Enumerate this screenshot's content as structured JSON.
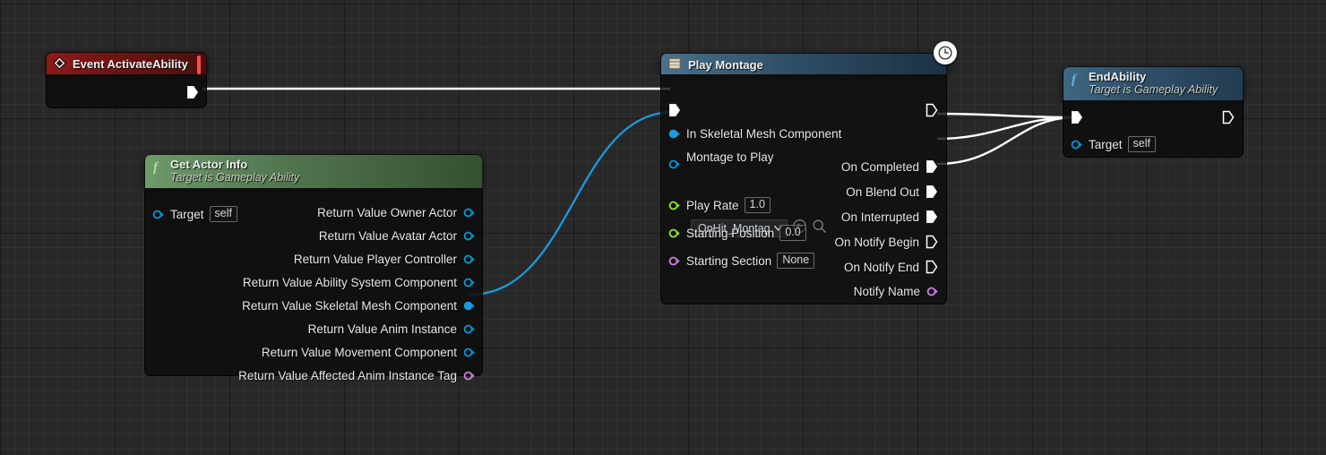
{
  "graph": {
    "background_color": "#282828",
    "grid_minor_color": "#333333",
    "grid_major_color": "#101010",
    "exec_wire_color": "#ffffff",
    "object_wire_color": "#189bdf"
  },
  "nodes": {
    "event_activate_ability": {
      "title": "Event ActivateAbility",
      "icon": "event-diamond-icon",
      "header_color": "#8d1a18",
      "breakpoint_icon": "red-square-icon",
      "exec_out_label": ""
    },
    "get_actor_info": {
      "title": "Get Actor Info",
      "subtitle": "Target is Gameplay Ability",
      "icon": "function-f-icon",
      "header_color": "#51754e",
      "inputs": [
        {
          "label": "Target",
          "value": "self",
          "pin_type": "object",
          "pin_color": "#0096d8",
          "connected": false
        }
      ],
      "outputs": [
        {
          "label": "Return Value Owner Actor",
          "pin_type": "object",
          "pin_color": "#0096d8",
          "connected": false
        },
        {
          "label": "Return Value Avatar Actor",
          "pin_type": "object",
          "pin_color": "#0096d8",
          "connected": false
        },
        {
          "label": "Return Value Player Controller",
          "pin_type": "object",
          "pin_color": "#0096d8",
          "connected": false
        },
        {
          "label": "Return Value Ability System Component",
          "pin_type": "object",
          "pin_color": "#0096d8",
          "connected": false
        },
        {
          "label": "Return Value Skeletal Mesh Component",
          "pin_type": "object",
          "pin_color": "#189bdf",
          "connected": true
        },
        {
          "label": "Return Value Anim Instance",
          "pin_type": "object",
          "pin_color": "#0096d8",
          "connected": false
        },
        {
          "label": "Return Value Movement Component",
          "pin_type": "object",
          "pin_color": "#0096d8",
          "connected": false
        },
        {
          "label": "Return Value Affected Anim Instance Tag",
          "pin_type": "struct",
          "pin_color": "#cc7bdd",
          "connected": false
        }
      ]
    },
    "play_montage": {
      "title": "Play Montage",
      "icon": "montage-asset-icon",
      "header_color": "#30506a",
      "latent_icon": "clock-icon",
      "inputs": [
        {
          "label": "",
          "pin_type": "exec",
          "connected": true
        },
        {
          "label": "In Skeletal Mesh Component",
          "pin_type": "object",
          "pin_color": "#189bdf",
          "connected": true
        },
        {
          "label": "Montage to Play",
          "pin_type": "object",
          "pin_color": "#0096d8",
          "connected": false,
          "combo_value": "OnHit_Montag",
          "combo_icon": "chevron-down-icon",
          "browse_icon": "browse-to-asset-icon",
          "search_icon": "magnifier-icon"
        },
        {
          "label": "Play Rate",
          "value": "1.0",
          "pin_type": "float",
          "pin_color": "#8fe02a",
          "connected": false
        },
        {
          "label": "Starting Position",
          "value": "0.0",
          "pin_type": "float",
          "pin_color": "#8fe02a",
          "connected": false
        },
        {
          "label": "Starting Section",
          "value": "None",
          "pin_type": "name",
          "pin_color": "#cc7bdd",
          "connected": false
        }
      ],
      "outputs": [
        {
          "label": "",
          "pin_type": "exec",
          "connected": false
        },
        {
          "label": "On Completed",
          "pin_type": "exec",
          "connected": true
        },
        {
          "label": "On Blend Out",
          "pin_type": "exec",
          "connected": true
        },
        {
          "label": "On Interrupted",
          "pin_type": "exec",
          "connected": true
        },
        {
          "label": "On Notify Begin",
          "pin_type": "exec",
          "connected": false
        },
        {
          "label": "On Notify End",
          "pin_type": "exec",
          "connected": false
        },
        {
          "label": "Notify Name",
          "pin_type": "name",
          "pin_color": "#cc7bdd",
          "connected": false
        }
      ]
    },
    "end_ability": {
      "title": "EndAbility",
      "subtitle": "Target is Gameplay Ability",
      "icon": "function-f-icon",
      "header_color": "#30506a",
      "inputs": [
        {
          "label": "",
          "pin_type": "exec",
          "connected": true
        },
        {
          "label": "Target",
          "value": "self",
          "pin_type": "object",
          "pin_color": "#0096d8",
          "connected": false
        }
      ],
      "outputs": [
        {
          "label": "",
          "pin_type": "exec",
          "connected": false
        }
      ]
    }
  }
}
